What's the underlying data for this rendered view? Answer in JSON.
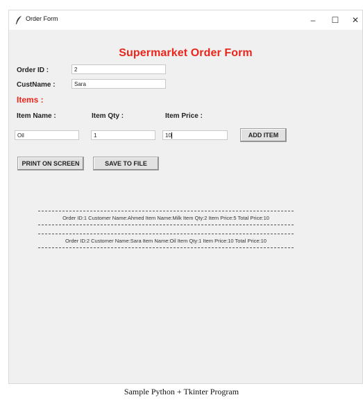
{
  "window": {
    "title": "Order Form",
    "minimize": "–",
    "maximize": "☐",
    "close": "✕"
  },
  "form": {
    "heading": "Supermarket Order Form",
    "order_id_label": "Order ID :",
    "order_id_value": "2",
    "custname_label": "CustName :",
    "custname_value": "Sara",
    "items_label": "Items :",
    "item_name_label": "Item Name :",
    "item_qty_label": "Item Qty :",
    "item_price_label": "Item Price :",
    "item_name_value": "Oil",
    "item_qty_value": "1",
    "item_price_value": "10",
    "add_item_button": "ADD ITEM",
    "print_button": "PRINT ON SCREEN",
    "save_button": "SAVE TO FILE"
  },
  "output": [
    "Order ID:1   Customer Name:Ahmed  Item Name:Milk  Item Qty:2  Item Price:5  Total Price:10",
    "Order ID:2   Customer Name:Sara  Item Name:Oil  Item Qty:1  Item Price:10  Total Price:10"
  ],
  "caption": "Sample Python + Tkinter Program"
}
